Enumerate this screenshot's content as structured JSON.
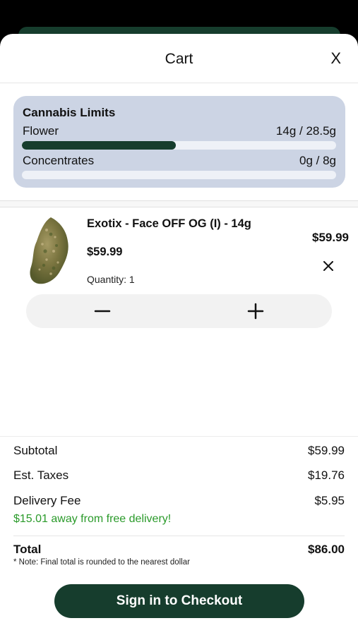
{
  "header": {
    "title": "Cart",
    "close_label": "X"
  },
  "limits": {
    "title": "Cannabis Limits",
    "rows": [
      {
        "label": "Flower",
        "value": "14g / 28.5g",
        "fraction": 0.49
      },
      {
        "label": "Concentrates",
        "value": "0g / 8g",
        "fraction": 0
      }
    ]
  },
  "item": {
    "name": "Exotix - Face OFF OG (I) - 14g",
    "unit_price": "$59.99",
    "quantity": "Quantity: 1",
    "line_total": "$59.99",
    "remove_icon": "close-icon"
  },
  "stepper": {
    "minus_icon": "minus-icon",
    "plus_icon": "plus-icon"
  },
  "summary": {
    "subtotal_label": "Subtotal",
    "subtotal_value": "$59.99",
    "taxes_label": "Est. Taxes",
    "taxes_value": "$19.76",
    "delivery_label": "Delivery Fee",
    "delivery_value": "$5.95",
    "free_delivery_note": "$15.01 away from free delivery!",
    "total_label": "Total",
    "total_value": "$86.00",
    "rounding_note": "* Note: Final total is rounded to the nearest dollar"
  },
  "checkout": {
    "label": "Sign in to Checkout"
  },
  "colors": {
    "brand": "#163d2d",
    "limits_bg": "#ccd4e4",
    "free_delivery": "#2a9a2a"
  }
}
